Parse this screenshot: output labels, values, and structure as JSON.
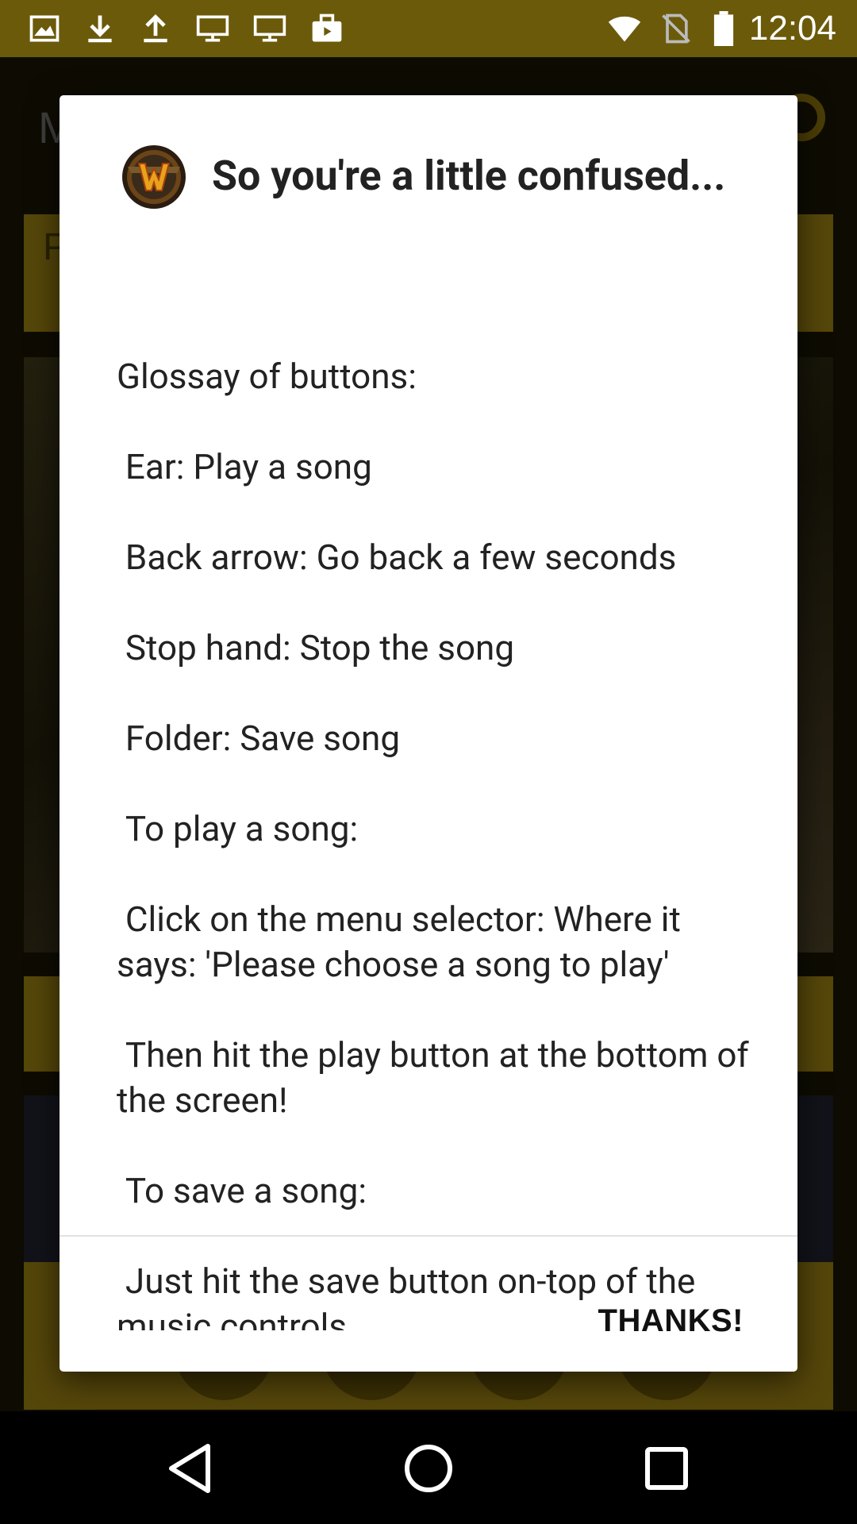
{
  "status_bar": {
    "time": "12:04",
    "left_icons": [
      "gallery-icon",
      "download-icon",
      "upload-icon",
      "monitor-icon",
      "monitor-icon",
      "briefcase-icon"
    ],
    "right_icons": [
      "wifi-icon",
      "no-sim-icon",
      "battery-icon"
    ],
    "background": "#6b5a0a"
  },
  "background_app": {
    "title_initial": "M",
    "selector_initial": "P",
    "accent": "#56470a"
  },
  "dialog": {
    "title": "So you're a little confused...",
    "icon": "warcraft-logo-icon",
    "message": "Glossay of buttons:\n\n Ear: Play a song\n\n Back arrow: Go back a few seconds\n\n Stop hand: Stop the song\n\n Folder: Save song\n\n To play a song:\n\n Click on the menu selector: Where it says: 'Please choose a song to play'\n\n Then hit the play button at the bottom of the screen!\n\n To save a song:\n\n Just hit the save button on-top of the music controls",
    "button_label": "THANKS!"
  },
  "nav_bar": {
    "buttons": [
      "back-icon",
      "home-icon",
      "recents-icon"
    ]
  }
}
